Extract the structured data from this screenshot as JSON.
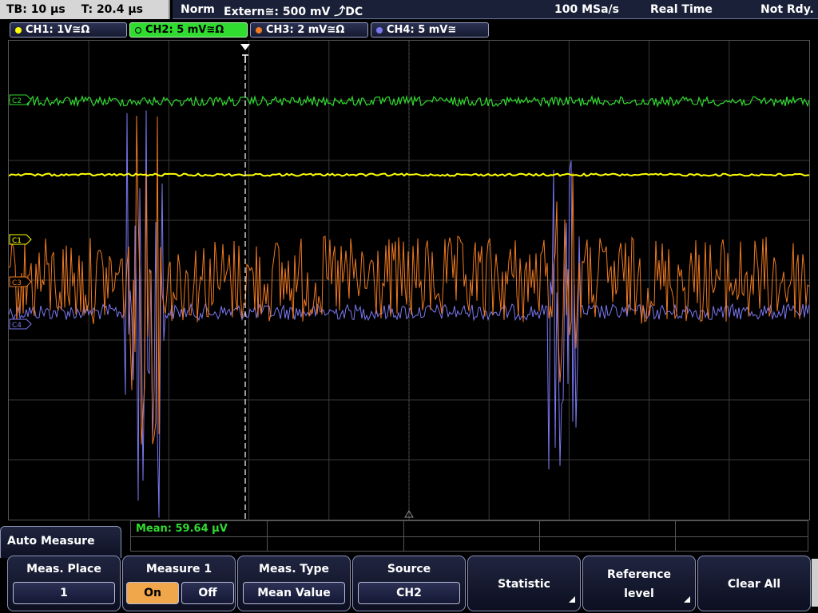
{
  "status": {
    "timebase": "TB: 10 µs",
    "trigger_time": "T: 20.4 µs",
    "trigger_mode": "Norm",
    "trigger_source": "Extern≅: 500 mV ⤴DC",
    "sample_rate": "100 MSa/s",
    "acq_mode": "Real Time",
    "state": "Not Rdy."
  },
  "channels": [
    {
      "label": "CH1: 1V≅Ω",
      "color": "#ffff00",
      "marker": "C1"
    },
    {
      "label": "CH2: 5 mV≅Ω",
      "color": "#2fdc2f",
      "marker": "C2"
    },
    {
      "label": "CH3: 2 mV≅Ω",
      "color": "#f07a20",
      "marker": "C3"
    },
    {
      "label": "CH4: 5 mV≅",
      "color": "#7b78f0",
      "marker": "C4"
    }
  ],
  "measurement": {
    "mean": "Mean: 59.64 µV"
  },
  "menu": {
    "title": "Auto Measure",
    "meas_place": {
      "title": "Meas. Place",
      "value": "1"
    },
    "measure1": {
      "title": "Measure 1",
      "on": "On",
      "off": "Off"
    },
    "meas_type": {
      "title": "Meas. Type",
      "value": "Mean Value"
    },
    "source": {
      "title": "Source",
      "value": "CH2"
    },
    "statistic": "Statistic",
    "reference": {
      "line1": "Reference",
      "line2": "level"
    },
    "clear_all": "Clear All"
  }
}
